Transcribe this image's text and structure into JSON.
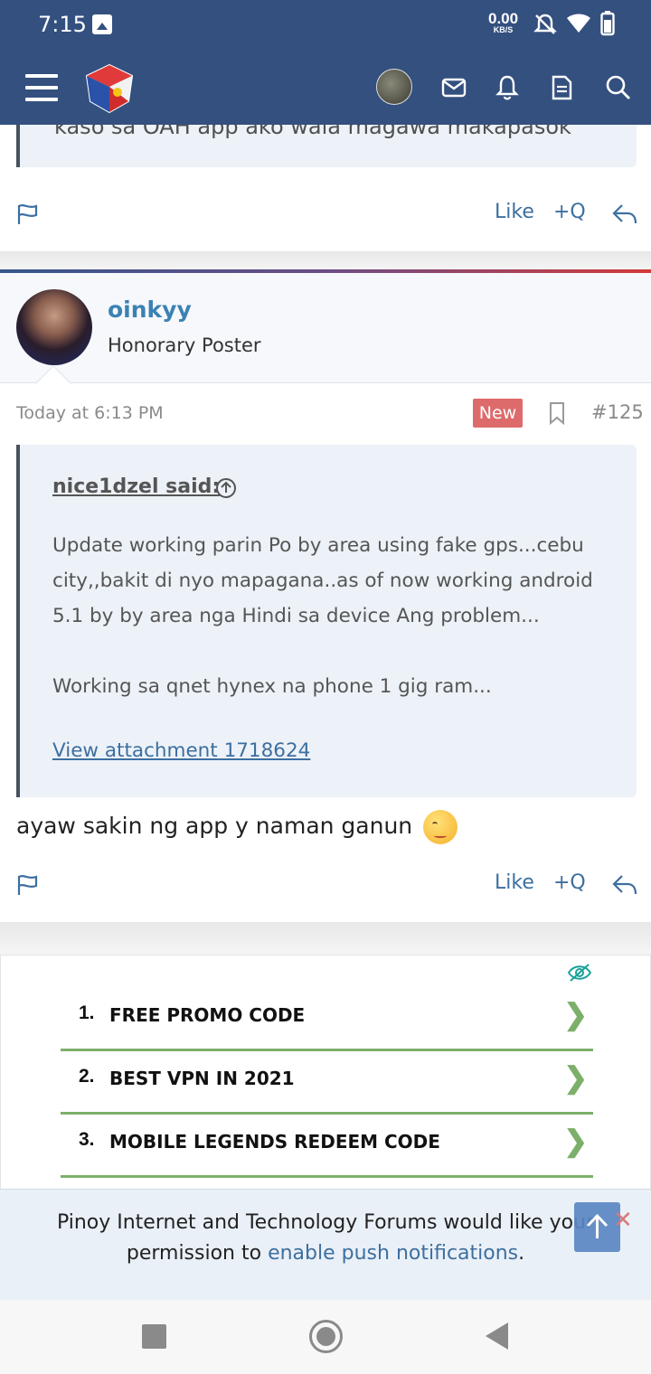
{
  "status_bar": {
    "time": "7:15",
    "net_speed": "0.00",
    "net_unit": "KB/S"
  },
  "prev_post": {
    "cut_text": "kaso sa OAH app ako wala magawa makapasok"
  },
  "actions": {
    "like": "Like",
    "quote": "+Q"
  },
  "post": {
    "username": "oinkyy",
    "user_title": "Honorary Poster",
    "time": "Today at 6:13 PM",
    "badge": "New",
    "number": "#125",
    "quote": {
      "author": "nice1dzel said:",
      "lines": [
        "Update working parin Po by area using fake gps...cebu city,,bakit di nyo mapagana..as of now working android 5.1 by by area nga Hindi sa device Ang problem...",
        "Working sa qnet hynex na phone 1 gig ram..."
      ],
      "attachment": "View attachment 1718624"
    },
    "message": "ayaw sakin ng app y naman ganun"
  },
  "ad": {
    "items": [
      {
        "num": "1.",
        "label": "FREE PROMO CODE"
      },
      {
        "num": "2.",
        "label": "BEST VPN IN 2021"
      },
      {
        "num": "3.",
        "label": "MOBILE LEGENDS REDEEM CODE"
      }
    ]
  },
  "push": {
    "text_before": "Pinoy Internet and Technology Forums would like your permission to ",
    "link": "enable push notifications",
    "text_after": "."
  },
  "colors": {
    "header": "#33507f",
    "link": "#3d6fa0",
    "badge_new": "#dd6b6b",
    "ad_accent": "#7cb06a"
  }
}
